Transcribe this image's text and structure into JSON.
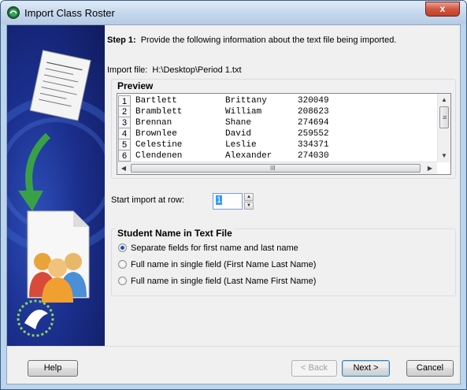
{
  "window": {
    "title": "Import Class Roster",
    "close_label": "x",
    "colors": {
      "frame": "#bcd4ec",
      "side_panel": "#1b2f8e",
      "selection": "#3399ff"
    }
  },
  "step": {
    "label": "Step 1:",
    "text": "Provide the following information about the text file being imported."
  },
  "import_file": {
    "label": "Import file:",
    "path": "H:\\Desktop\\Period 1.txt"
  },
  "preview": {
    "title": "Preview",
    "rows": [
      {
        "num": "1",
        "last": "Bartlett",
        "first": "Brittany",
        "id": "320049"
      },
      {
        "num": "2",
        "last": "Bramblett",
        "first": "William",
        "id": "208623"
      },
      {
        "num": "3",
        "last": "Brennan",
        "first": "Shane",
        "id": "274694"
      },
      {
        "num": "4",
        "last": "Brownlee",
        "first": "David",
        "id": "259552"
      },
      {
        "num": "5",
        "last": "Celestine",
        "first": "Leslie",
        "id": "334371"
      },
      {
        "num": "6",
        "last": "Clendenen",
        "first": "Alexander",
        "id": "274030"
      }
    ],
    "hscroll_grip": "III"
  },
  "start_row": {
    "label": "Start import at row:",
    "value": "1"
  },
  "student_name": {
    "title": "Student Name in Text File",
    "options": [
      {
        "label": "Separate fields for first name and last name",
        "selected": true
      },
      {
        "label": "Full name in single field (First Name Last Name)",
        "selected": false
      },
      {
        "label": "Full name in single field (Last Name First Name)",
        "selected": false
      }
    ]
  },
  "buttons": {
    "help": "Help",
    "back": "< Back",
    "next": "Next >",
    "cancel": "Cancel"
  },
  "icons": {
    "app": "roster-app-icon",
    "close": "close-icon",
    "side_art": "import-wizard-illustration"
  }
}
